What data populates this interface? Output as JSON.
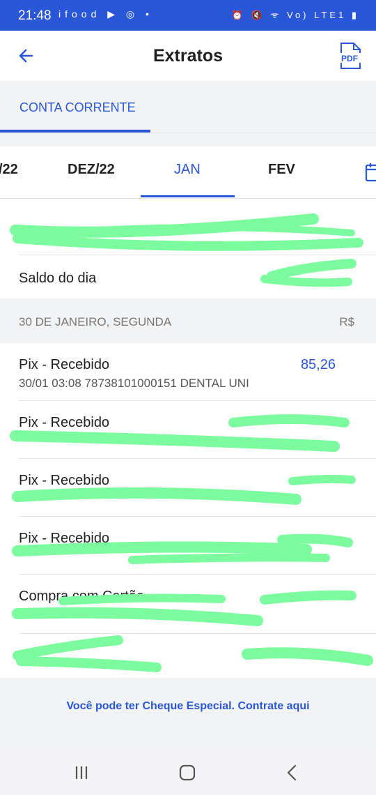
{
  "status": {
    "time": "21:48",
    "left_icons": "ifood ▶ ◎ •",
    "right_icons": "⏰ 🔇 ᯤ Vo) LTE1 ▮"
  },
  "appbar": {
    "title": "Extratos",
    "back_icon": "arrow-left-icon",
    "pdf_icon": "pdf-icon"
  },
  "tabs": {
    "active": "CONTA CORRENTE"
  },
  "months": [
    "/22",
    "DEZ/22",
    "JAN",
    "FEV"
  ],
  "summary": {
    "row1_label": "",
    "saldo_label": "Saldo do dia"
  },
  "date_group": {
    "date": "30 DE JANEIRO, SEGUNDA",
    "currency": "R$"
  },
  "transactions": [
    {
      "title": "Pix - Recebido",
      "subtitle": "30/01 03:08 78738101000151 DENTAL UNI",
      "amount": "85,26"
    },
    {
      "title": "Pix - Recebido",
      "subtitle": "",
      "amount": ""
    },
    {
      "title": "Pix - Recebido",
      "subtitle": "",
      "amount": ""
    },
    {
      "title": "Pix - Recebido",
      "subtitle": "",
      "amount": ""
    },
    {
      "title": "Compra com Cartão",
      "subtitle": "",
      "amount": ""
    }
  ],
  "last_row": {
    "label": "",
    "amount": ""
  },
  "footer": {
    "link": "Você pode ter Cheque Especial. Contrate aqui"
  },
  "nav": {
    "recents": "recents-icon",
    "home": "home-icon",
    "back": "back-icon"
  },
  "colors": {
    "accent": "#2a56d8",
    "redaction": "#7dfb9f"
  }
}
